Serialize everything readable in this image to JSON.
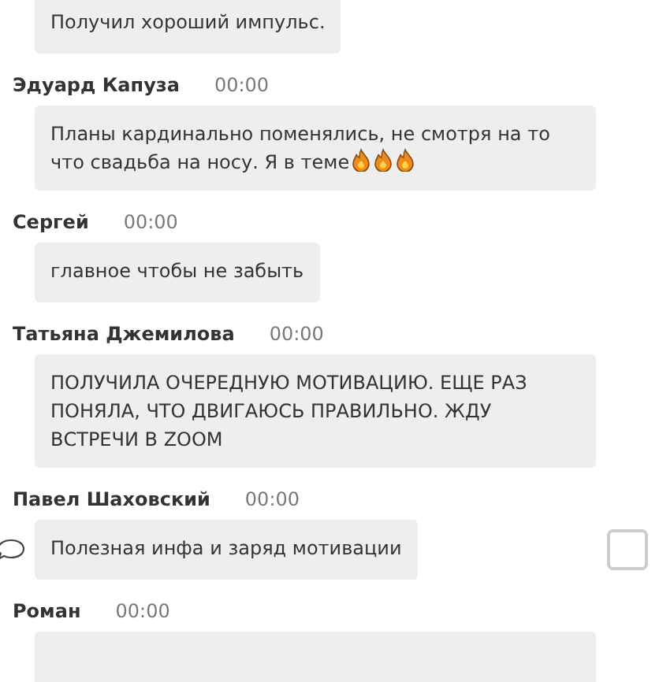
{
  "messages": [
    {
      "text": "Получил хороший импульс."
    },
    {
      "author": "Эдуард Капуза",
      "time": "00:00",
      "text": "Планы кардинально поменялись, не смотря на то что свадьба на носу. Я в теме",
      "trailing_icons": [
        {
          "kind": "fire"
        },
        {
          "kind": "fire"
        },
        {
          "kind": "fire"
        }
      ]
    },
    {
      "author": "Сергей",
      "time": "00:00",
      "text": "главное чтобы не забыть"
    },
    {
      "author": "Татьяна Джемилова",
      "time": "00:00",
      "text": "ПОЛУЧИЛА ОЧЕРЕДНУЮ МОТИВАЦИЮ. ЕЩЕ РАЗ ПОНЯЛА, ЧТО ДВИГАЮСЬ ПРАВИЛЬНО. ЖДУ ВСТРЕЧИ В ZOOM"
    },
    {
      "author": "Павел Шаховский",
      "time": "00:00",
      "text": "Полезная инфа и заряд мотивации",
      "comment_icon": true,
      "checkbox": {
        "checked": false
      }
    },
    {
      "author": "Роман",
      "time": "00:00"
    }
  ]
}
